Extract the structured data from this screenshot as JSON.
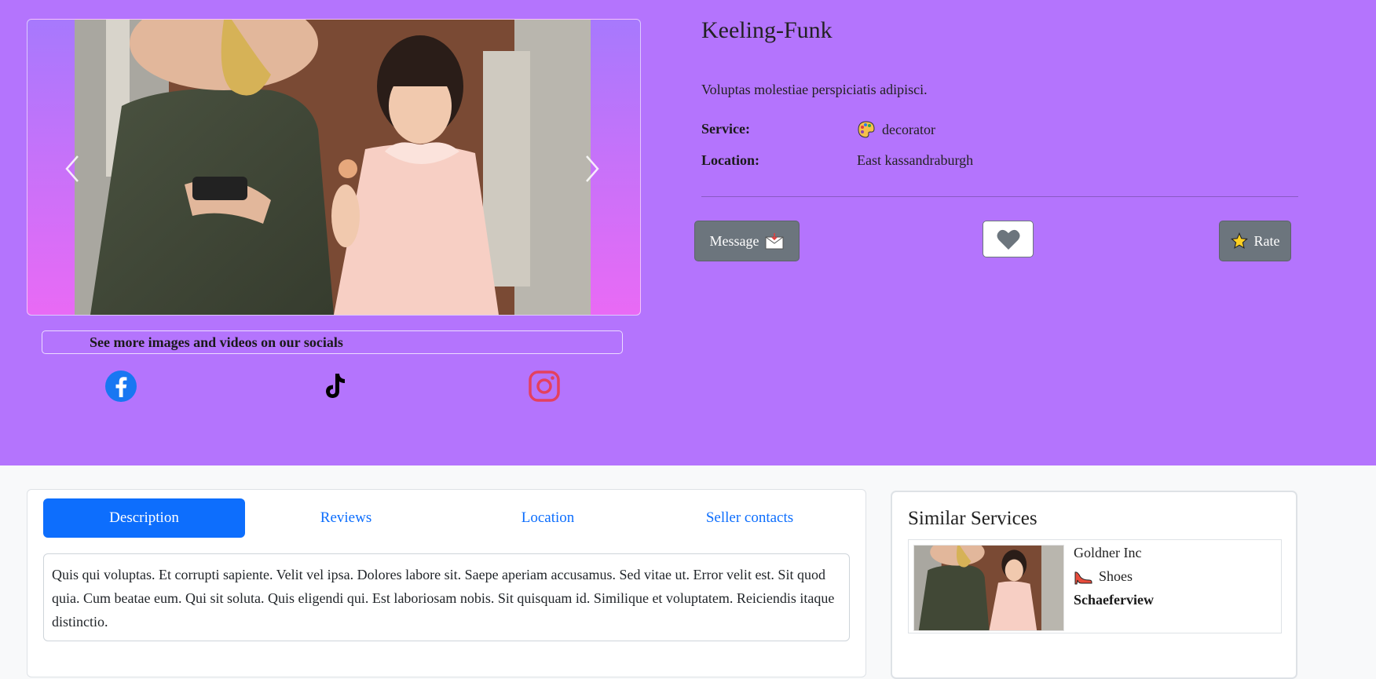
{
  "listing": {
    "title": "Keeling-Funk",
    "subtitle": "Voluptas molestiae perspiciatis adipisci.",
    "service_label": "Service:",
    "service_value": "decorator",
    "service_icon": "palette-icon",
    "location_label": "Location:",
    "location_value": "East kassandraburgh"
  },
  "carousel": {
    "prev_icon": "chevron-left-icon",
    "next_icon": "chevron-right-icon"
  },
  "socials": {
    "banner": "See more images and videos on our socials",
    "items": [
      {
        "name": "facebook-icon",
        "color": "#1877f2"
      },
      {
        "name": "tiktok-icon",
        "color": "#000000"
      },
      {
        "name": "instagram-icon",
        "color": "#e4405f"
      }
    ]
  },
  "actions": {
    "message_label": "Message",
    "message_icon": "envelope-icon",
    "favorite_icon": "heart-icon",
    "rate_label": "Rate",
    "rate_icon": "star-icon"
  },
  "tabs": [
    {
      "label": "Description",
      "active": true
    },
    {
      "label": "Reviews",
      "active": false
    },
    {
      "label": "Location",
      "active": false
    },
    {
      "label": "Seller contacts",
      "active": false
    }
  ],
  "description": "Quis qui voluptas. Et corrupti sapiente. Velit vel ipsa. Dolores labore sit. Saepe aperiam accusamus. Sed vitae ut. Error velit est. Sit quod quia. Cum beatae eum. Qui sit soluta. Quis eligendi qui. Est laboriosam nobis. Sit quisquam id. Similique et voluptatem. Reiciendis itaque distinctio.",
  "similar": {
    "title": "Similar Services",
    "items": [
      {
        "name": "Goldner Inc",
        "category": "Shoes",
        "category_icon": "high-heel-icon",
        "location": "Schaeferview"
      }
    ]
  },
  "colors": {
    "hero_bg": "#b474fd",
    "primary": "#0d6efd",
    "secondary": "#6c757d"
  }
}
